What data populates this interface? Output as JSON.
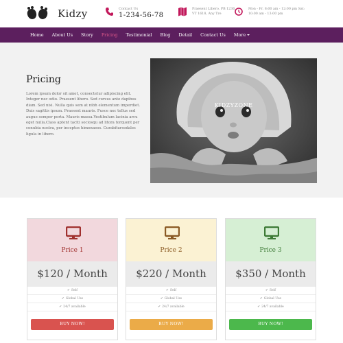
{
  "header": {
    "brand": "Kidzy",
    "contact": {
      "label": "Contact Us",
      "phone": "1-234-56-78"
    },
    "address": "Praesent Libero. PB 1236, VT 1618, Any Tre",
    "hours": "Mon - Fr. 8:00 am - 12:00 pm Sat: 10:00 am - 13:00 pm"
  },
  "nav": {
    "items": [
      "Home",
      "About Us",
      "Story",
      "Pricing",
      "Testimonial",
      "Blog",
      "Detail",
      "Contact Us",
      "More"
    ],
    "active": "Pricing"
  },
  "hero": {
    "title": "Pricing",
    "body": "Lorem ipsum dolor sit amet, consectetur adipiscing elit. Integer nec odio. Praesent libero. Sed cursus ante dapibus diam. Sed nisi. Nulla quis sem at nibh elementum imperdiet. Duis sagittis ipsum. Praesent mauris. Fusce nec tellus sed augue semper porta. Mauris massa.Vestibulum lacinia arcu eget nulla.Class aptent taciti sociosqu ad litora torquent per conubia nostra, per inceptos himenaeos. Curabitursodales ligula in libero.",
    "watermark": "KIDZYZONE"
  },
  "plans": [
    {
      "name": "Price 1",
      "price": "$120 / Month",
      "features": [
        "Self",
        "Global Use",
        "24/7 available"
      ],
      "button": "BUY NOW!",
      "head_color": "#f2d8dd",
      "accent": "#a0302e",
      "button_color": "#d9534f"
    },
    {
      "name": "Price 2",
      "price": "$220 / Month",
      "features": [
        "Self",
        "Global Use",
        "24/7 available"
      ],
      "button": "BUY NOW!",
      "head_color": "#fbf2d3",
      "accent": "#8a5a24",
      "button_color": "#ebab48"
    },
    {
      "name": "Price 3",
      "price": "$350 / Month",
      "features": [
        "Self",
        "Global Use",
        "24/7 available"
      ],
      "button": "BUY NOW!",
      "head_color": "#d6efd4",
      "accent": "#3d7a36",
      "button_color": "#4cb84c"
    }
  ],
  "colors": {
    "nav_bg": "#5c1f5e",
    "accent_pink": "#e0598b",
    "hero_bg": "#f2f2f2"
  }
}
